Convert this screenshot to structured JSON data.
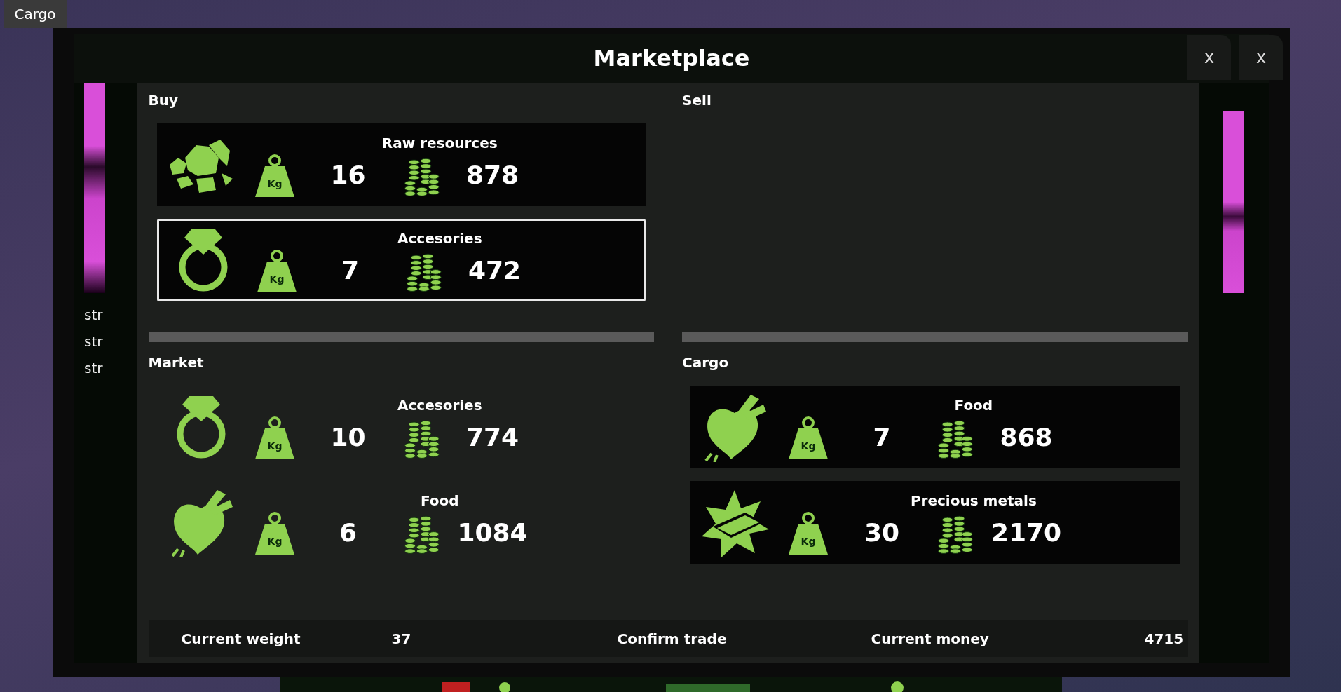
{
  "desktop_button": {
    "label": "Cargo"
  },
  "window": {
    "title": "Marketplace",
    "close_buttons": [
      "x",
      "x"
    ]
  },
  "side_labels": [
    "str",
    "str",
    "str"
  ],
  "sections": [
    {
      "title": "Buy",
      "kind": "framed",
      "items": [
        {
          "name": "Raw resources",
          "kind": "raw_resources",
          "weight_unit": "Kg",
          "weight": "16",
          "price": "878",
          "selected": false
        },
        {
          "name": "Accesories",
          "kind": "accessories",
          "weight_unit": "Kg",
          "weight": "7",
          "price": "472",
          "selected": true
        }
      ]
    },
    {
      "title": "Sell"
    },
    {
      "title": "Market",
      "kind": "plain",
      "items": [
        {
          "name": "Accesories",
          "kind": "accessories",
          "weight_unit": "Kg",
          "weight": "10",
          "price": "774",
          "selected": false
        },
        {
          "name": "Food",
          "kind": "food",
          "weight_unit": "Kg",
          "weight": "6",
          "price": "1084",
          "selected": false
        }
      ]
    },
    {
      "title": "Cargo",
      "kind": "framed",
      "items": [
        {
          "name": "Food",
          "kind": "food",
          "weight_unit": "Kg",
          "weight": "7",
          "price": "868",
          "selected": false
        },
        {
          "name": "Precious metals",
          "kind": "precious_metals",
          "weight_unit": "Kg",
          "weight": "30",
          "price": "2170",
          "selected": false
        }
      ]
    }
  ],
  "footer": {
    "weight_label": "Current weight",
    "weight": "37",
    "confirm": "Confirm trade",
    "money_label": "Current money",
    "money": "4715"
  }
}
